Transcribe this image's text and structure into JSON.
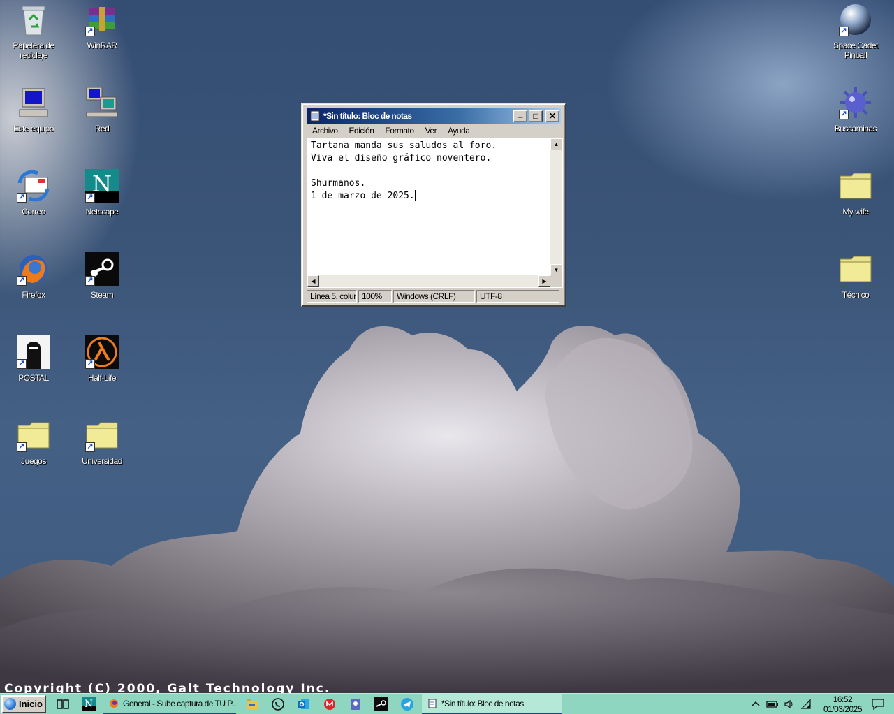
{
  "desktop": {
    "icons_left": [
      {
        "label": "Papelera de reciclaje",
        "icon": "recycle-bin-icon"
      },
      {
        "label": "WinRAR",
        "icon": "winrar-icon"
      },
      {
        "label": "Este equipo",
        "icon": "computer-icon"
      },
      {
        "label": "Red",
        "icon": "network-icon"
      },
      {
        "label": "Correo",
        "icon": "mail-icon"
      },
      {
        "label": "Netscape",
        "icon": "netscape-icon"
      },
      {
        "label": "Firefox",
        "icon": "firefox-icon"
      },
      {
        "label": "Steam",
        "icon": "steam-icon"
      },
      {
        "label": "POSTAL",
        "icon": "postal-icon"
      },
      {
        "label": "Half-Life",
        "icon": "half-life-icon"
      },
      {
        "label": "Juegos",
        "icon": "folder-icon"
      },
      {
        "label": "Universidad",
        "icon": "folder-icon"
      }
    ],
    "icons_right": [
      {
        "label": "Space Cadet Pinball",
        "icon": "pinball-icon"
      },
      {
        "label": "Buscaminas",
        "icon": "minesweeper-icon"
      },
      {
        "label": "My wife",
        "icon": "folder-icon"
      },
      {
        "label": "Técnico",
        "icon": "folder-icon"
      }
    ],
    "copyright": "Copyright (C) 2000, Galt Technology Inc."
  },
  "notepad": {
    "title": "*Sin título: Bloc de notas",
    "menu": [
      "Archivo",
      "Edición",
      "Formato",
      "Ver",
      "Ayuda"
    ],
    "content_lines": [
      "Tartana manda sus saludos al foro.",
      "Viva el diseño gráfico noventero.",
      "",
      "Shurmanos.",
      "1 de marzo de 2025."
    ],
    "status": {
      "position": "Línea 5, colun",
      "zoom": "100%",
      "line_ending": "Windows (CRLF)",
      "encoding": "UTF-8"
    },
    "buttons": {
      "minimize": "_",
      "maximize": "□",
      "close": "✕"
    }
  },
  "taskbar": {
    "start_label": "Inicio",
    "pinned": [
      "task-view-icon",
      "netscape-icon",
      "file-explorer-icon",
      "whatsapp-icon",
      "outlook-icon",
      "mega-icon",
      "authenticator-icon",
      "steam-icon",
      "telegram-icon"
    ],
    "tasks": [
      {
        "label": "General - Sube captura de TU P...",
        "icon": "firefox-icon"
      },
      {
        "label": "*Sin título: Bloc de notas",
        "icon": "notepad-icon"
      }
    ],
    "tray_icons": [
      "chevron-up-icon",
      "battery-icon",
      "volume-icon",
      "wifi-icon"
    ],
    "time": "16:52",
    "date": "01/03/2025",
    "notification_icon": "notification-icon"
  },
  "colors": {
    "taskbar": "#8fd6c0",
    "titlebar_start": "#0a246a",
    "titlebar_end": "#a6caf0",
    "window_face": "#d4d0c8"
  }
}
